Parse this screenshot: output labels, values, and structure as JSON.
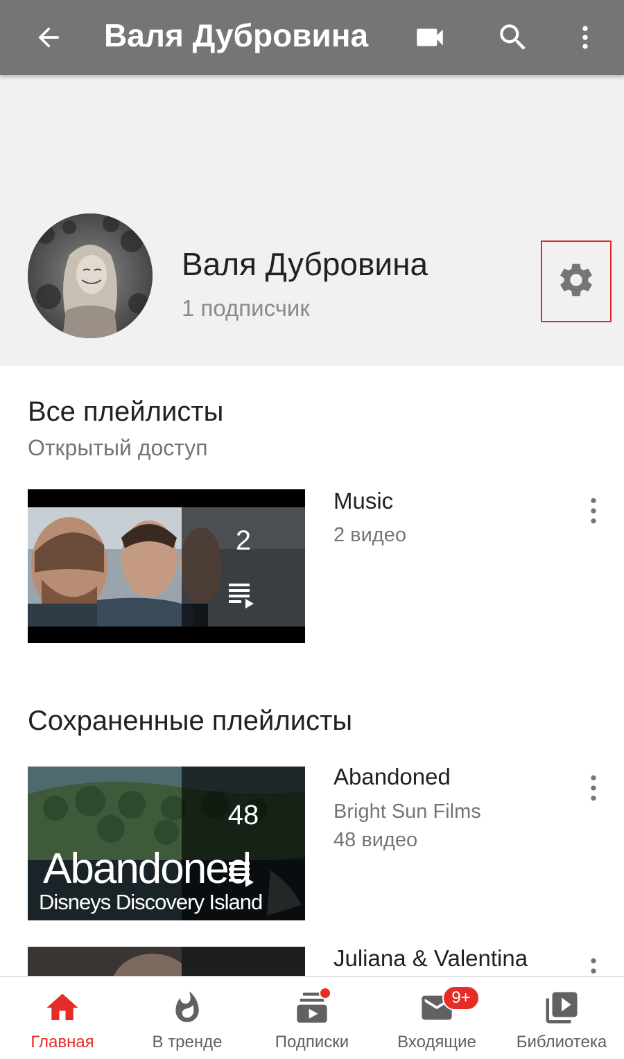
{
  "appbar": {
    "title": "Валя Дубровина",
    "back_icon": "arrow-back-icon",
    "camera_icon": "videocam-icon",
    "search_icon": "search-icon",
    "more_icon": "more-vert-icon"
  },
  "channel": {
    "name": "Валя Дубровина",
    "subscribers": "1 подписчик",
    "settings_icon": "gear-icon",
    "highlight_color": "#e8252b"
  },
  "sections": {
    "all_playlists": {
      "title": "Все плейлисты",
      "subtitle": "Открытый доступ",
      "items": [
        {
          "title": "Music",
          "meta1": "2 видео",
          "count": "2"
        }
      ]
    },
    "saved_playlists": {
      "title": "Сохраненные плейлисты",
      "items": [
        {
          "title": "Abandoned",
          "meta1": "Bright Sun Films",
          "meta2": "48 видео",
          "count": "48",
          "thumb_text_1": "Abandoned",
          "thumb_text_2": "Disneys Discovery Island"
        },
        {
          "title": "Juliana & Valentina"
        }
      ]
    }
  },
  "bottom_nav": {
    "items": [
      {
        "label": "Главная",
        "icon": "home-icon",
        "active": true
      },
      {
        "label": "В тренде",
        "icon": "trending-flame-icon"
      },
      {
        "label": "Подписки",
        "icon": "subscriptions-icon",
        "badge": "dot"
      },
      {
        "label": "Входящие",
        "icon": "inbox-mail-icon",
        "badge": "9+"
      },
      {
        "label": "Библиотека",
        "icon": "library-icon"
      }
    ]
  },
  "colors": {
    "appbar": "#757575",
    "header_bg": "#f1f1f1",
    "accent": "#e52d27"
  }
}
